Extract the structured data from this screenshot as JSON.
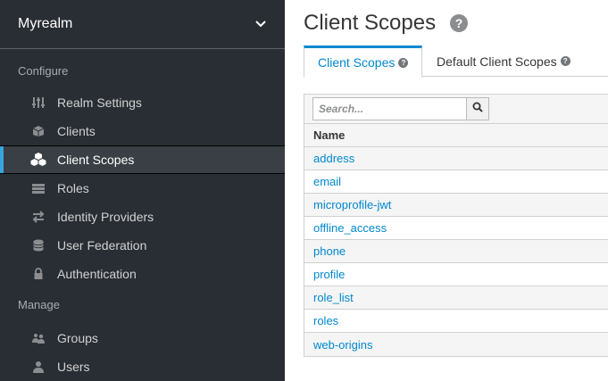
{
  "sidebar": {
    "realm": "Myrealm",
    "configure_title": "Configure",
    "manage_title": "Manage",
    "configure_items": [
      {
        "label": "Realm Settings",
        "icon": "sliders-icon"
      },
      {
        "label": "Clients",
        "icon": "cube-icon"
      },
      {
        "label": "Client Scopes",
        "icon": "cubes-icon",
        "active": true
      },
      {
        "label": "Roles",
        "icon": "list-icon"
      },
      {
        "label": "Identity Providers",
        "icon": "exchange-icon"
      },
      {
        "label": "User Federation",
        "icon": "database-icon"
      },
      {
        "label": "Authentication",
        "icon": "lock-icon"
      }
    ],
    "manage_items": [
      {
        "label": "Groups",
        "icon": "users-icon"
      },
      {
        "label": "Users",
        "icon": "user-icon"
      }
    ]
  },
  "main": {
    "title": "Client Scopes",
    "tabs": [
      {
        "label": "Client Scopes",
        "active": true
      },
      {
        "label": "Default Client Scopes",
        "active": false
      }
    ],
    "search": {
      "placeholder": "Search...",
      "value": ""
    },
    "table": {
      "header": "Name",
      "rows": [
        "address",
        "email",
        "microprofile-jwt",
        "offline_access",
        "phone",
        "profile",
        "role_list",
        "roles",
        "web-origins"
      ]
    }
  },
  "colors": {
    "sidebar_bg": "#292e34",
    "accent": "#39a5dc",
    "link": "#0088ce"
  }
}
